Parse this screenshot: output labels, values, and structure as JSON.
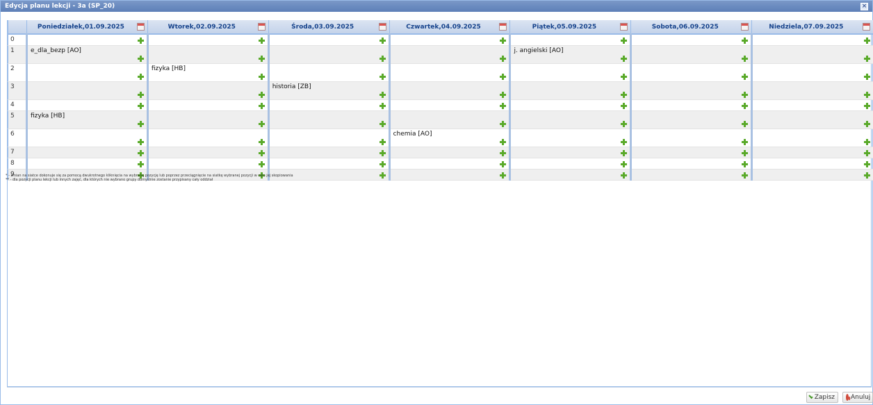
{
  "window": {
    "title": "Edycja planu lekcji - 3a (SP_20)"
  },
  "days": [
    "Poniedziałek,01.09.2025",
    "Wtorek,02.09.2025",
    "Środa,03.09.2025",
    "Czwartek,04.09.2025",
    "Piątek,05.09.2025",
    "Sobota,06.09.2025",
    "Niedziela,07.09.2025"
  ],
  "rows": [
    {
      "index": "0",
      "cells": [
        "",
        "",
        "",
        "",
        "",
        "",
        ""
      ]
    },
    {
      "index": "1",
      "cells": [
        "e_dla_bezp [AO]",
        "",
        "",
        "",
        "j. angielski [AO]",
        "",
        ""
      ]
    },
    {
      "index": "2",
      "cells": [
        "",
        "fizyka [HB]",
        "",
        "",
        "",
        "",
        ""
      ]
    },
    {
      "index": "3",
      "cells": [
        "",
        "",
        "historia [ZB]",
        "",
        "",
        "",
        ""
      ]
    },
    {
      "index": "4",
      "cells": [
        "",
        "",
        "",
        "",
        "",
        "",
        ""
      ]
    },
    {
      "index": "5",
      "cells": [
        "fizyka [HB]",
        "",
        "",
        "",
        "",
        "",
        ""
      ]
    },
    {
      "index": "6",
      "cells": [
        "",
        "",
        "",
        "chemia [AO]",
        "",
        "",
        ""
      ]
    },
    {
      "index": "7",
      "cells": [
        "",
        "",
        "",
        "",
        "",
        "",
        ""
      ]
    },
    {
      "index": "8",
      "cells": [
        "",
        "",
        "",
        "",
        "",
        "",
        ""
      ]
    },
    {
      "index": "9",
      "cells": [
        "",
        "",
        "",
        "",
        "",
        "",
        ""
      ]
    }
  ],
  "notes": [
    "* - zmian na siatce dokonuje się za pomocą dwukrotnego kliknięcia na wybraną pozycję lub poprzez przeciągnięcie na siatkę wybranej pozycji w celu jej skopiowania",
    "** - dla pozycji planu lekcji lub innych zajęć, dla których nie wybrano grupy domyślnie zostanie przypisany cały oddział"
  ],
  "buttons": {
    "save": "Zapisz",
    "cancel": "Anuluj"
  }
}
